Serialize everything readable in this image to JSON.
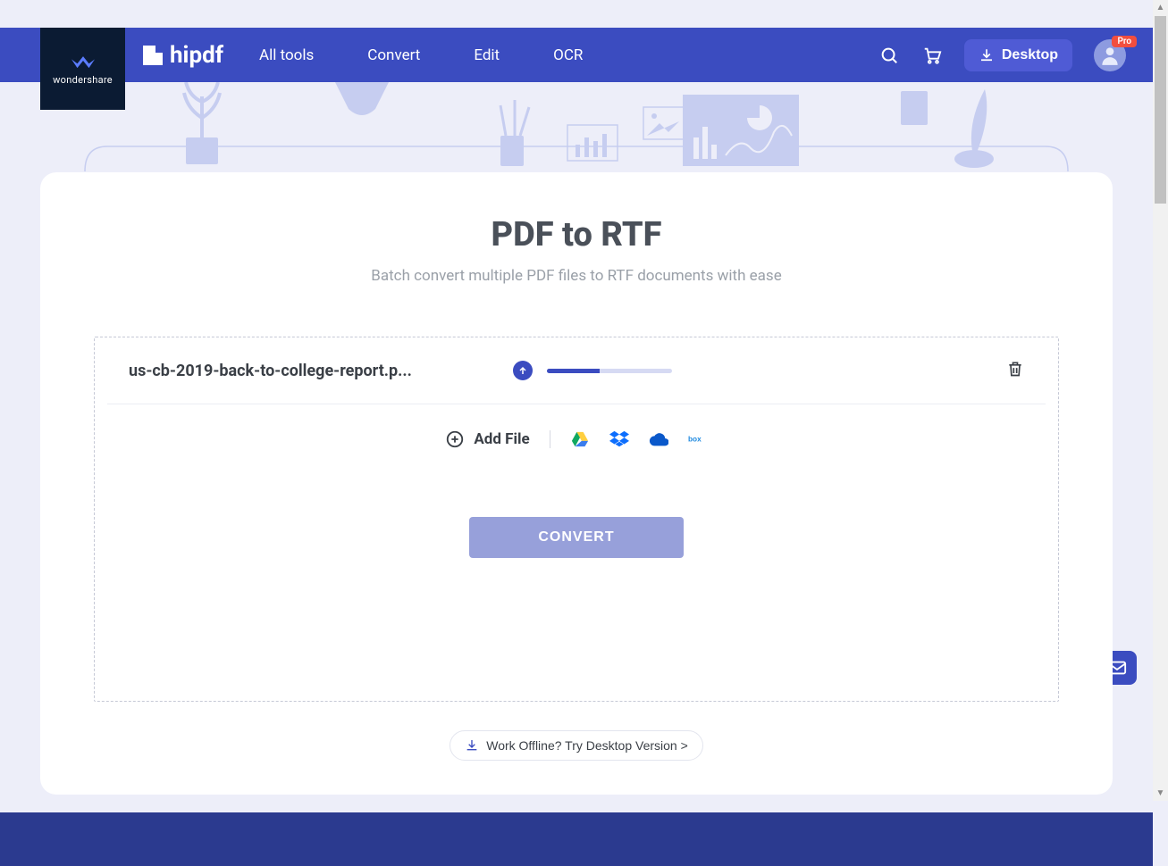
{
  "brand": {
    "wondershare": "wondershare",
    "hipdf": "hipdf"
  },
  "nav": {
    "all_tools": "All tools",
    "convert": "Convert",
    "edit": "Edit",
    "ocr": "OCR"
  },
  "header": {
    "desktop_btn": "Desktop",
    "pro_badge": "Pro"
  },
  "page": {
    "title": "PDF to RTF",
    "subtitle": "Batch convert multiple PDF files to RTF documents with ease"
  },
  "file": {
    "name": "us-cb-2019-back-to-college-report.p...",
    "progress_pct": 42
  },
  "add": {
    "label": "Add File"
  },
  "cloud": {
    "gdrive": "google-drive",
    "dropbox": "dropbox",
    "onedrive": "onedrive",
    "box": "box"
  },
  "actions": {
    "convert": "CONVERT",
    "offline": "Work Offline? Try Desktop Version >"
  }
}
